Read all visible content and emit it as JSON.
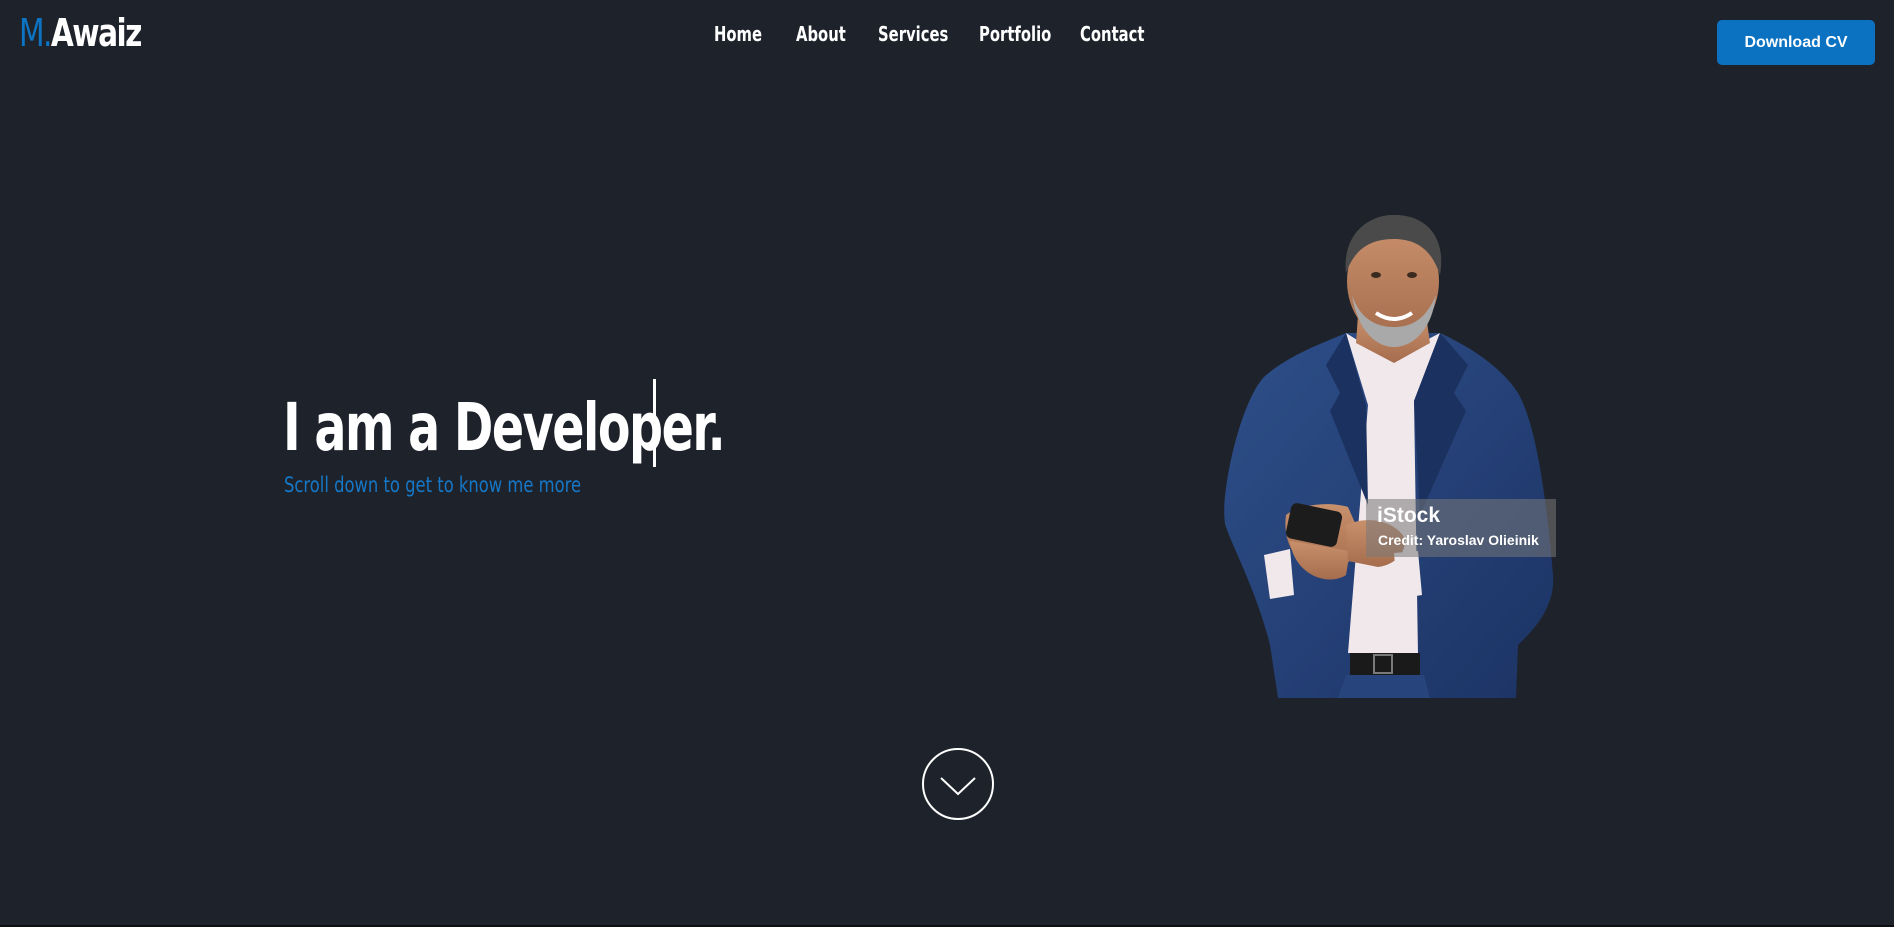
{
  "header": {
    "logo": {
      "initial": "M.",
      "name": "Awaiz"
    },
    "nav": [
      {
        "label": "Home"
      },
      {
        "label": "About"
      },
      {
        "label": "Services"
      },
      {
        "label": "Portfolio"
      },
      {
        "label": "Contact"
      }
    ],
    "cta_label": "Download CV"
  },
  "hero": {
    "headline": "I am a Developer.",
    "subline": "Scroll down to get to know me more",
    "image": {
      "watermark_brand": "iStock",
      "watermark_credit": "Credit: Yaroslav Olieinik"
    },
    "scroll_icon": "chevron-down-icon"
  },
  "colors": {
    "background": "#1e232b",
    "accent": "#0b72c2",
    "text": "#ffffff"
  }
}
